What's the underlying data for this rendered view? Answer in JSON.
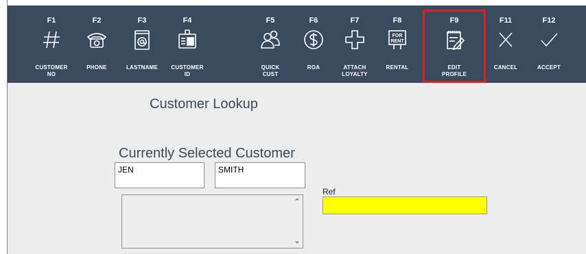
{
  "toolbar": {
    "buttons": [
      {
        "key": "F1",
        "label": "CUSTOMER\nNO",
        "icon": "hash-icon"
      },
      {
        "key": "F2",
        "label": "PHONE",
        "icon": "phone-icon"
      },
      {
        "key": "F3",
        "label": "LASTNAME",
        "icon": "at-icon"
      },
      {
        "key": "F4",
        "label": "CUSTOMER\nID",
        "icon": "id-badge-icon"
      },
      {
        "key": "F5",
        "label": "QUICK\nCUST",
        "icon": "people-icon"
      },
      {
        "key": "F6",
        "label": "ROA",
        "icon": "dollar-icon"
      },
      {
        "key": "F7",
        "label": "ATTACH\nLOYALTY",
        "icon": "plus-icon"
      },
      {
        "key": "F8",
        "label": "RENTAL",
        "icon": "for-rent-icon",
        "icon_text": "FOR\nRENT"
      },
      {
        "key": "F9",
        "label": "EDIT\nPROFILE",
        "icon": "edit-notepad-icon"
      },
      {
        "key": "F11",
        "label": "CANCEL",
        "icon": "x-icon"
      },
      {
        "key": "F12",
        "label": "ACCEPT",
        "icon": "check-icon"
      }
    ],
    "highlight_color": "#e02020",
    "background": "#3a4a5f"
  },
  "main": {
    "title": "Customer Lookup",
    "section_title": "Currently Selected Customer",
    "first_name": "JEN",
    "last_name": "SMITH",
    "memo": "",
    "ref_label": "Ref",
    "ref_value": "",
    "ref_color": "#ffff00"
  }
}
